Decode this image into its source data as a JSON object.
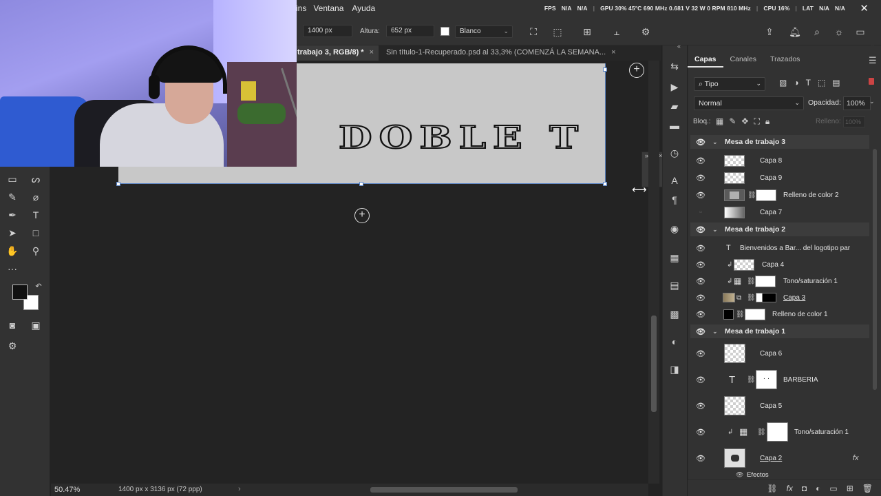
{
  "menu": {
    "items": [
      "ins",
      "Ventana",
      "Ayuda"
    ]
  },
  "perf": {
    "fps_label": "FPS",
    "fps_value": "N/A",
    "fps_value2": "N/A",
    "gpu": "GPU 30% 45°C 690 MHz 0.681 V 32 W 0 RPM 810 MHz",
    "cpu": "CPU 16%",
    "lat": "LAT",
    "lat_value": "N/A",
    "lat_value2": "N/A"
  },
  "options": {
    "width_value": "1400 px",
    "height_label": "Altura:",
    "height_value": "652 px",
    "bg_select": "Blanco"
  },
  "tabs": {
    "active": "trabajo 3, RGB/8) *",
    "inactive": "Sin título-1-Recuperado.psd al 33,3% (COMENZÁ LA SEMANA..."
  },
  "canvas": {
    "art_text": "DOBLE T"
  },
  "status": {
    "zoom": "50.47%",
    "dimensions": "1400 px x 3136 px (72 ppp)"
  },
  "layers_panel": {
    "tabs": [
      "Capas",
      "Canales",
      "Trazados"
    ],
    "filter": "Tipo",
    "blend_mode": "Normal",
    "opacity_label": "Opacidad:",
    "opacity_value": "100%",
    "lock_label": "Bloq.:",
    "fill_label": "Relleno:",
    "fill_value": "100%",
    "rows": [
      "Mesa de trabajo 3",
      "Capa 8",
      "Capa 9",
      "Relleno de color 2",
      "Capa 7",
      "Mesa de trabajo 2",
      "Bienvenidos a Bar... del logotipo par",
      "Capa 4",
      "Tono/saturación 1",
      "Capa 3",
      "Relleno de color 1",
      "Mesa de trabajo 1",
      "Capa 6",
      "BARBERIA",
      "Capa 5",
      "Tono/saturación 1",
      "Capa 2",
      "Efectos"
    ]
  },
  "colors": {
    "accent_blue": "#5b84c4",
    "panel_bg": "#323232",
    "canvas_bg": "#232323",
    "artboard": "#c8c8c8"
  }
}
